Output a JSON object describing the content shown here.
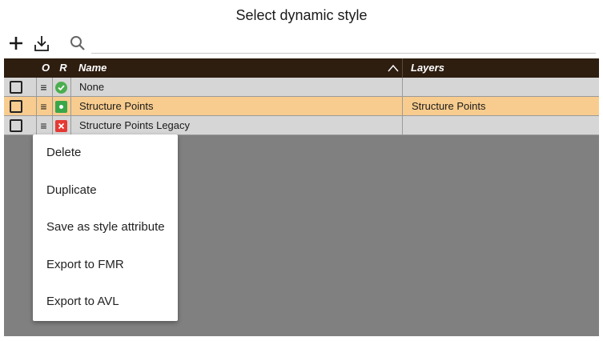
{
  "title": "Select dynamic style",
  "toolbar": {
    "add_icon": "plus-icon",
    "import_icon": "download-icon",
    "search_icon": "search-icon",
    "search_value": "",
    "search_placeholder": ""
  },
  "table": {
    "columns": {
      "o": "O",
      "r": "R",
      "name": "Name",
      "layers": "Layers"
    },
    "sort": "ascending",
    "rows": [
      {
        "checked": false,
        "order_icon": "≡",
        "status": "ok",
        "name": "None",
        "layers": ""
      },
      {
        "checked": false,
        "order_icon": "≡",
        "status": "active",
        "name": "Structure Points",
        "layers": "Structure Points",
        "selected": true
      },
      {
        "checked": false,
        "order_icon": "≡",
        "status": "error",
        "name": "Structure Points Legacy",
        "layers": ""
      }
    ]
  },
  "context_menu": {
    "items": [
      {
        "label": "Delete"
      },
      {
        "label": "Duplicate"
      },
      {
        "label": "Save as style attribute"
      },
      {
        "label": "Export to FMR"
      },
      {
        "label": "Export to AVL"
      }
    ]
  },
  "colors": {
    "header_bg": "#2e1e10",
    "selected_row": "#f8cc8e",
    "row_bg": "#d6d6d6",
    "backdrop": "#808080",
    "status_ok": "#4cae4f",
    "status_error": "#e53935"
  }
}
